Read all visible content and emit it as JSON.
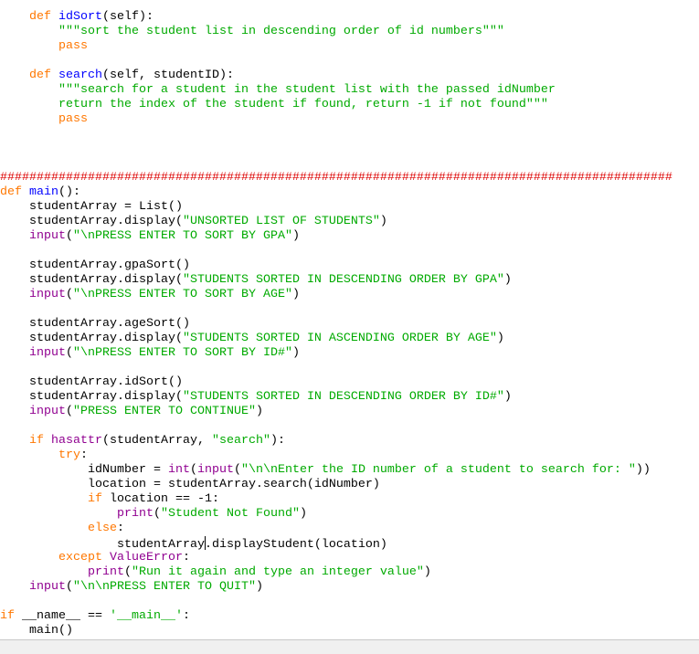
{
  "editor": {
    "language": "python",
    "colors": {
      "keyword": "#ff7700",
      "definition": "#0000ff",
      "string": "#00aa00",
      "builtin": "#900090",
      "comment": "#dd0000",
      "text": "#000000"
    },
    "cursor": {
      "line": 37,
      "after_text": "studentArray"
    },
    "lines": [
      [
        [
          "    ",
          ""
        ],
        [
          "def",
          "kw"
        ],
        [
          " ",
          ""
        ],
        [
          "idSort",
          "def"
        ],
        [
          "(self):",
          ""
        ]
      ],
      [
        [
          "        ",
          ""
        ],
        [
          "\"\"\"sort the student list in descending order of id numbers\"\"\"",
          "str"
        ]
      ],
      [
        [
          "        ",
          ""
        ],
        [
          "pass",
          "kw"
        ]
      ],
      [],
      [
        [
          "    ",
          ""
        ],
        [
          "def",
          "kw"
        ],
        [
          " ",
          ""
        ],
        [
          "search",
          "def"
        ],
        [
          "(self, studentID):",
          ""
        ]
      ],
      [
        [
          "        ",
          ""
        ],
        [
          "\"\"\"search for a student in the student list with the passed idNumber",
          "str"
        ]
      ],
      [
        [
          "        ",
          ""
        ],
        [
          "return the index of the student if found, return -1 if not found\"\"\"",
          "str"
        ]
      ],
      [
        [
          "        ",
          ""
        ],
        [
          "pass",
          "kw"
        ]
      ],
      [],
      [],
      [],
      [
        [
          "############################################################################################",
          "cm"
        ]
      ],
      [
        [
          "def",
          "kw"
        ],
        [
          " ",
          ""
        ],
        [
          "main",
          "def"
        ],
        [
          "():",
          ""
        ]
      ],
      [
        [
          "    studentArray = List()",
          ""
        ]
      ],
      [
        [
          "    studentArray.display(",
          ""
        ],
        [
          "\"UNSORTED LIST OF STUDENTS\"",
          "str"
        ],
        [
          ")",
          ""
        ]
      ],
      [
        [
          "    ",
          ""
        ],
        [
          "input",
          "bi"
        ],
        [
          "(",
          ""
        ],
        [
          "\"\\nPRESS ENTER TO SORT BY GPA\"",
          "str"
        ],
        [
          ")",
          ""
        ]
      ],
      [],
      [
        [
          "    studentArray.gpaSort()",
          ""
        ]
      ],
      [
        [
          "    studentArray.display(",
          ""
        ],
        [
          "\"STUDENTS SORTED IN DESCENDING ORDER BY GPA\"",
          "str"
        ],
        [
          ")",
          ""
        ]
      ],
      [
        [
          "    ",
          ""
        ],
        [
          "input",
          "bi"
        ],
        [
          "(",
          ""
        ],
        [
          "\"\\nPRESS ENTER TO SORT BY AGE\"",
          "str"
        ],
        [
          ")",
          ""
        ]
      ],
      [],
      [
        [
          "    studentArray.ageSort()",
          ""
        ]
      ],
      [
        [
          "    studentArray.display(",
          ""
        ],
        [
          "\"STUDENTS SORTED IN ASCENDING ORDER BY AGE\"",
          "str"
        ],
        [
          ")",
          ""
        ]
      ],
      [
        [
          "    ",
          ""
        ],
        [
          "input",
          "bi"
        ],
        [
          "(",
          ""
        ],
        [
          "\"\\nPRESS ENTER TO SORT BY ID#\"",
          "str"
        ],
        [
          ")",
          ""
        ]
      ],
      [],
      [
        [
          "    studentArray.idSort()",
          ""
        ]
      ],
      [
        [
          "    studentArray.display(",
          ""
        ],
        [
          "\"STUDENTS SORTED IN DESCENDING ORDER BY ID#\"",
          "str"
        ],
        [
          ")",
          ""
        ]
      ],
      [
        [
          "    ",
          ""
        ],
        [
          "input",
          "bi"
        ],
        [
          "(",
          ""
        ],
        [
          "\"PRESS ENTER TO CONTINUE\"",
          "str"
        ],
        [
          ")",
          ""
        ]
      ],
      [],
      [
        [
          "    ",
          ""
        ],
        [
          "if",
          "kw"
        ],
        [
          " ",
          ""
        ],
        [
          "hasattr",
          "bi"
        ],
        [
          "(studentArray, ",
          ""
        ],
        [
          "\"search\"",
          "str"
        ],
        [
          "):",
          ""
        ]
      ],
      [
        [
          "        ",
          ""
        ],
        [
          "try",
          "kw"
        ],
        [
          ":",
          ""
        ]
      ],
      [
        [
          "            idNumber = ",
          ""
        ],
        [
          "int",
          "bi"
        ],
        [
          "(",
          ""
        ],
        [
          "input",
          "bi"
        ],
        [
          "(",
          ""
        ],
        [
          "\"\\n\\nEnter the ID number of a student to search for: \"",
          "str"
        ],
        [
          "))",
          ""
        ]
      ],
      [
        [
          "            location = studentArray.search(idNumber)",
          ""
        ]
      ],
      [
        [
          "            ",
          ""
        ],
        [
          "if",
          "kw"
        ],
        [
          " location == -1:",
          ""
        ]
      ],
      [
        [
          "                ",
          ""
        ],
        [
          "print",
          "bi"
        ],
        [
          "(",
          ""
        ],
        [
          "\"Student Not Found\"",
          "str"
        ],
        [
          ")",
          ""
        ]
      ],
      [
        [
          "            ",
          ""
        ],
        [
          "else",
          "kw"
        ],
        [
          ":",
          ""
        ]
      ],
      [
        [
          "                studentArray",
          ""
        ],
        [
          "|CURSOR|",
          "cursor"
        ],
        [
          ".displayStudent(location)",
          ""
        ]
      ],
      [
        [
          "        ",
          ""
        ],
        [
          "except",
          "kw"
        ],
        [
          " ",
          ""
        ],
        [
          "ValueError",
          "bi"
        ],
        [
          ":",
          ""
        ]
      ],
      [
        [
          "            ",
          ""
        ],
        [
          "print",
          "bi"
        ],
        [
          "(",
          ""
        ],
        [
          "\"Run it again and type an integer value\"",
          "str"
        ],
        [
          ")",
          ""
        ]
      ],
      [
        [
          "    ",
          ""
        ],
        [
          "input",
          "bi"
        ],
        [
          "(",
          ""
        ],
        [
          "\"\\n\\nPRESS ENTER TO QUIT\"",
          "str"
        ],
        [
          ")",
          ""
        ]
      ],
      [],
      [
        [
          "if",
          "kw"
        ],
        [
          " __name__ == ",
          ""
        ],
        [
          "'__main__'",
          "str"
        ],
        [
          ":",
          ""
        ]
      ],
      [
        [
          "    main()",
          ""
        ]
      ]
    ]
  },
  "statusbar": {}
}
